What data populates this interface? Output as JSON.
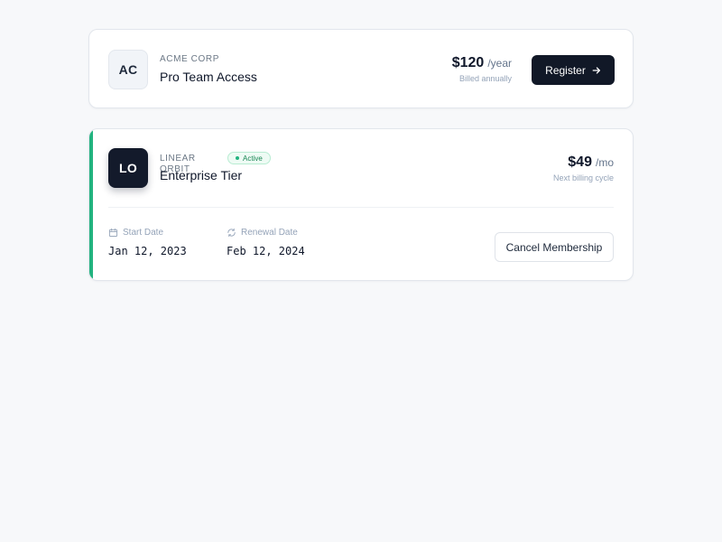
{
  "subscriptions": [
    {
      "avatar_initials": "AC",
      "org": "ACME CORP",
      "plan": "Pro Team Access",
      "price": "$120",
      "period": "/year",
      "price_note": "Billed annually",
      "action_label": "Register",
      "action_icon": "arrow-right-icon"
    },
    {
      "avatar_initials": "LO",
      "org": "LINEAR ORBIT",
      "status": "Active",
      "plan": "Enterprise Tier",
      "price": "$49",
      "period": "/mo",
      "price_note": "Next billing cycle",
      "start_date_label": "Start Date",
      "start_date": "Jan 12, 2023",
      "renewal_date_label": "Renewal Date",
      "renewal_date": "Feb 12, 2024",
      "action_label": "Cancel Membership",
      "accent_color": "#22b37f",
      "status_color": "#22b37f"
    }
  ]
}
